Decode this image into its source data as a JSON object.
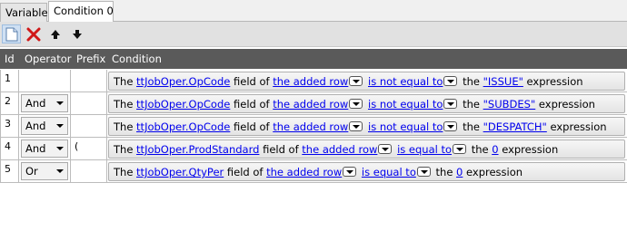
{
  "tabs": [
    "Variables",
    "Condition 0"
  ],
  "toolbar": {
    "icons": [
      "new-icon",
      "delete-icon",
      "arrow-up-icon",
      "arrow-down-icon"
    ]
  },
  "columns": {
    "id": "Id",
    "operator": "Operator",
    "prefix": "Prefix",
    "condition": "Condition"
  },
  "rows": [
    {
      "id": "1",
      "operator": "",
      "prefix": "",
      "the": "The",
      "field": "ttJobOper.OpCode",
      "field_of": "field of",
      "rowref": "the added row",
      "comparison": "is not equal to",
      "the2": "the",
      "value": "\"ISSUE\"",
      "suffix": "expression"
    },
    {
      "id": "2",
      "operator": "And",
      "prefix": "",
      "the": "The",
      "field": "ttJobOper.OpCode",
      "field_of": "field of",
      "rowref": "the added row",
      "comparison": "is not equal to",
      "the2": "the",
      "value": "\"SUBDES\"",
      "suffix": "expression"
    },
    {
      "id": "3",
      "operator": "And",
      "prefix": "",
      "the": "The",
      "field": "ttJobOper.OpCode",
      "field_of": "field of",
      "rowref": "the added row",
      "comparison": "is not equal to",
      "the2": "the",
      "value": "\"DESPATCH\"",
      "suffix": "expression"
    },
    {
      "id": "4",
      "operator": "And",
      "prefix": "(",
      "the": "The",
      "field": "ttJobOper.ProdStandard",
      "field_of": "field of",
      "rowref": "the added row",
      "comparison": "is equal to",
      "the2": "the",
      "value": "0",
      "suffix": "expression"
    },
    {
      "id": "5",
      "operator": "Or",
      "prefix": "",
      "the": "The",
      "field": "ttJobOper.QtyPer",
      "field_of": "field of",
      "rowref": "the added row",
      "comparison": "is equal to",
      "the2": "the",
      "value": "0",
      "suffix": "expression"
    }
  ]
}
